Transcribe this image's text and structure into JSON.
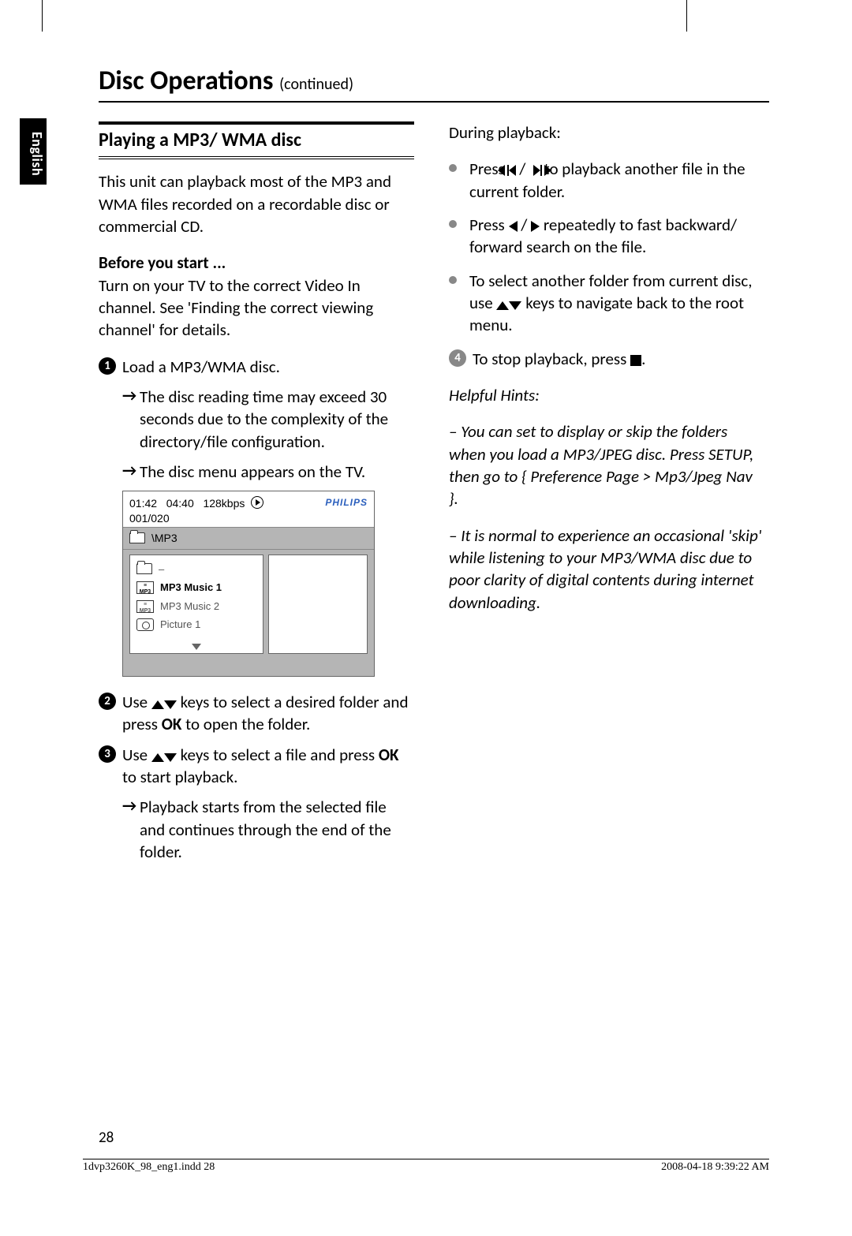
{
  "crop": {
    "visible": true
  },
  "language_tab": "English",
  "title_main": "Disc Operations ",
  "title_sub": "(continued)",
  "section_heading": "Playing a MP3/ WMA disc",
  "col1": {
    "intro": "This unit can playback most of the MP3 and WMA files recorded on a recordable disc or commercial CD.",
    "before_heading": "Before you start ...",
    "before_text": "Turn on your TV to the correct Video In channel. See 'Finding the correct viewing channel' for details.",
    "step1": "Load a MP3/WMA disc.",
    "step1_a": "The disc reading time may exceed 30 seconds due to the complexity of the directory/file configuration.",
    "step1_b": "The disc menu appears on the TV.",
    "step2_a": "Use ",
    "step2_b": " keys to select a desired folder and press ",
    "step2_ok": "OK",
    "step2_c": " to open the folder.",
    "step3_a": "Use ",
    "step3_b": " keys to select a file and press ",
    "step3_ok": "OK",
    "step3_c": " to start playback.",
    "step3_arrow": "Playback starts from the selected file and continues through the end of the folder."
  },
  "menu": {
    "time1": "01:42",
    "time2": "04:40",
    "bitrate": "128kbps",
    "track": "001/020",
    "brand": "PHILIPS",
    "path": "\\MP3",
    "items": [
      {
        "label": "–",
        "icon": "folder",
        "selected": false
      },
      {
        "label": "MP3 Music 1",
        "icon": "mp3",
        "selected": true
      },
      {
        "label": "MP3 Music 2",
        "icon": "mp3",
        "selected": false
      },
      {
        "label": "Picture 1",
        "icon": "cam",
        "selected": false
      }
    ]
  },
  "col2": {
    "during": "During playback:",
    "b1_a": "Press  ",
    "b1_b": " to playback another file in the current folder.",
    "b2_a": "Press ",
    "b2_b": " repeatedly to fast backward/ forward search on the file.",
    "b3_a": "To select another folder from current disc, use ",
    "b3_b": " keys to navigate back to the root menu.",
    "step4_a": "To stop playback, press ",
    "step4_b": ".",
    "hints_heading": "Helpful Hints:",
    "hint1": "–   You can set to display or skip the folders when you load a MP3/JPEG disc. Press SETUP, then go to { Preference Page > Mp3/Jpeg Nav }.",
    "hint2": "–   It is normal to experience an occasional 'skip' while listening to your MP3/WMA disc due to poor clarity of digital contents during internet downloading."
  },
  "page_number": "28",
  "footer_left": "1dvp3260K_98_eng1.indd   28",
  "footer_right": "2008-04-18   9:39:22 AM"
}
